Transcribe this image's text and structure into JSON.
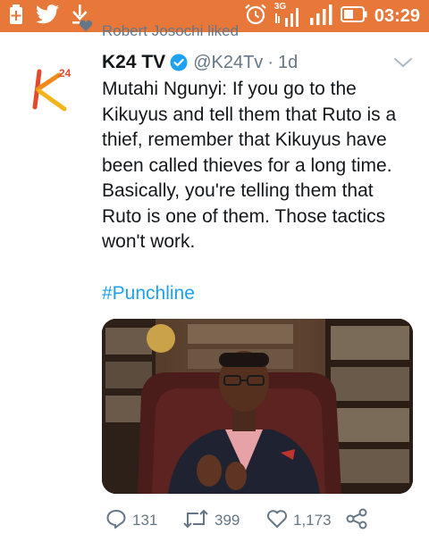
{
  "status_bar": {
    "time": "03:29",
    "network": "3G",
    "icons": [
      "battery-saver-icon",
      "twitter-icon",
      "download-icon",
      "alarm-icon",
      "signal-3g-icon",
      "signal-icon",
      "battery-icon"
    ],
    "background": "#e8773a"
  },
  "context": {
    "text": "Robert Josochi liked",
    "icon": "heart-icon"
  },
  "tweet": {
    "avatar": "k24-logo",
    "author_name": "K24 TV",
    "verified": true,
    "handle": "@K24Tv",
    "separator": "·",
    "time": "1d",
    "text": "Mutahi Ngunyi: If you go to the Kikuyus and tell them that Ruto is a thief, remember that Kikuyus have been called thieves for a long time. Basically, you're telling them that Ruto is one of them. Those tactics won't work.",
    "hashtag": "#Punchline",
    "media": "photo-man-in-armchair-bookshelves"
  },
  "actions": {
    "reply_count": "131",
    "retweet_count": "399",
    "like_count": "1,173"
  },
  "colors": {
    "link": "#1da1f2",
    "secondary": "#657786",
    "text": "#14171a"
  }
}
